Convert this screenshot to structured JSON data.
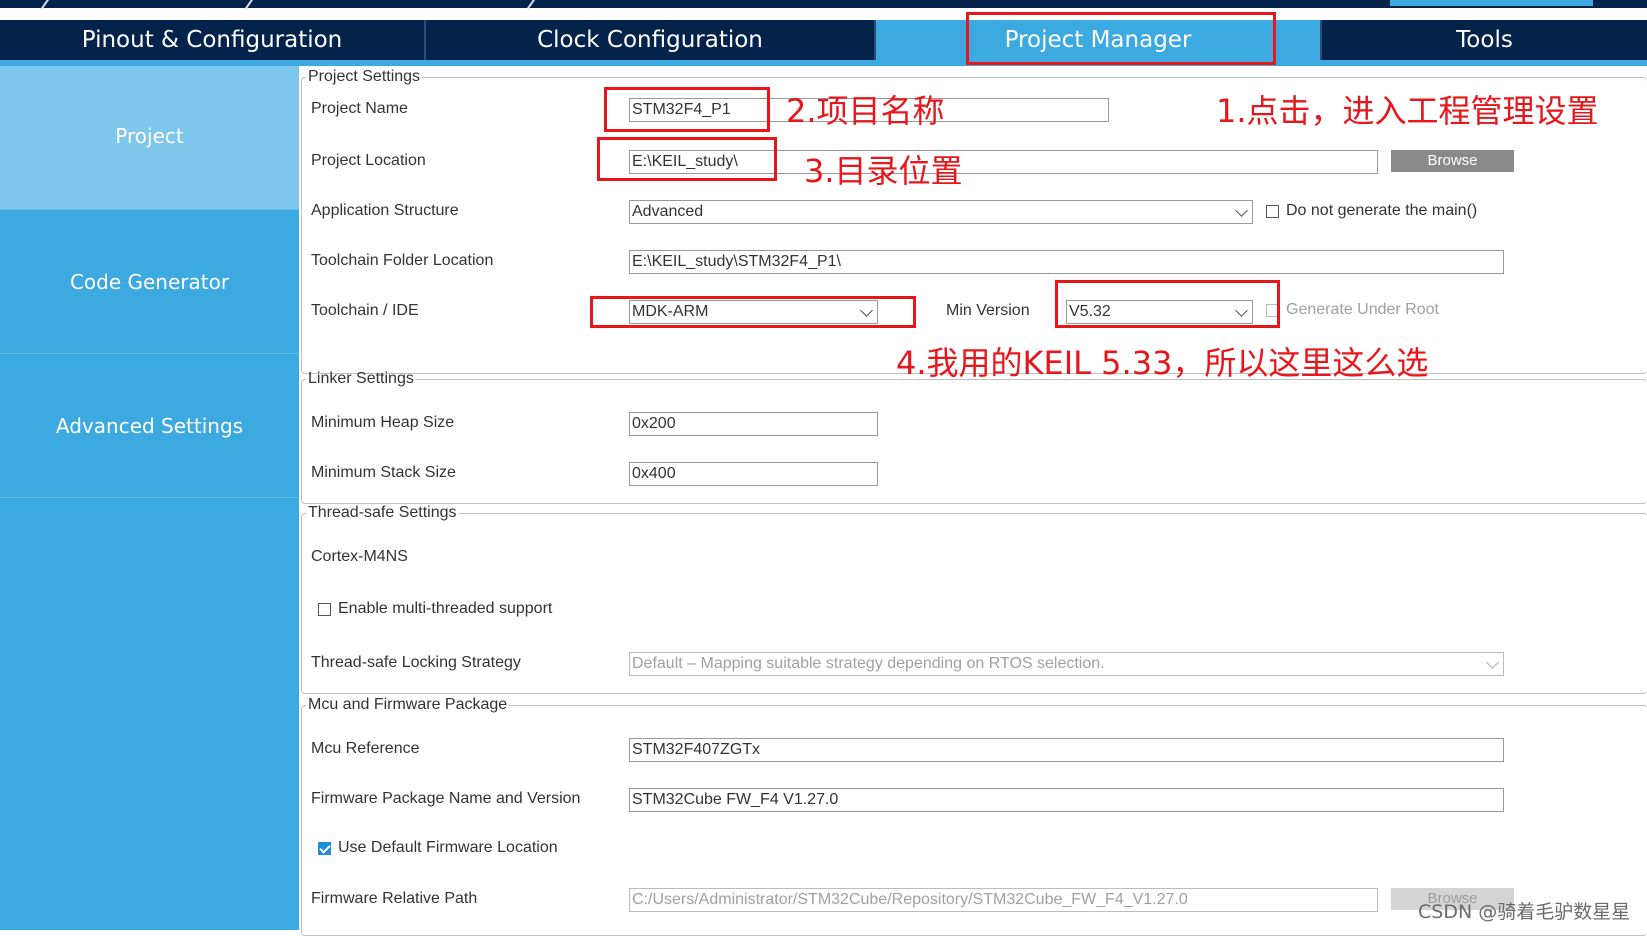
{
  "tabs": [
    {
      "label": "Pinout & Configuration",
      "active": false
    },
    {
      "label": "Clock Configuration",
      "active": false
    },
    {
      "label": "Project Manager",
      "active": true
    },
    {
      "label": "Tools",
      "active": false
    }
  ],
  "sidebar": {
    "items": [
      {
        "label": "Project",
        "active": true
      },
      {
        "label": "Code Generator",
        "active": false
      },
      {
        "label": "Advanced Settings",
        "active": false
      }
    ]
  },
  "project_settings": {
    "legend": "Project Settings",
    "project_name_label": "Project Name",
    "project_name_value": "STM32F4_P1",
    "project_location_label": "Project Location",
    "project_location_value": "E:\\KEIL_study\\",
    "browse_label": "Browse",
    "app_structure_label": "Application Structure",
    "app_structure_value": "Advanced",
    "no_main_label": "Do not generate the main()",
    "no_main_checked": false,
    "toolchain_folder_label": "Toolchain Folder Location",
    "toolchain_folder_value": "E:\\KEIL_study\\STM32F4_P1\\",
    "toolchain_label": "Toolchain / IDE",
    "toolchain_value": "MDK-ARM",
    "min_version_label": "Min Version",
    "min_version_value": "V5.32",
    "gen_under_root_label": "Generate Under Root",
    "gen_under_root_checked": false
  },
  "linker_settings": {
    "legend": "Linker Settings",
    "heap_label": "Minimum Heap Size",
    "heap_value": "0x200",
    "stack_label": "Minimum Stack Size",
    "stack_value": "0x400"
  },
  "thread_safe": {
    "legend": "Thread-safe Settings",
    "core": "Cortex-M4NS",
    "multi_thread_label": "Enable multi-threaded support",
    "multi_thread_checked": false,
    "strategy_label": "Thread-safe Locking Strategy",
    "strategy_value": "Default  –  Mapping suitable strategy depending on RTOS selection."
  },
  "mcu_firmware": {
    "legend": "Mcu and Firmware Package",
    "mcu_ref_label": "Mcu Reference",
    "mcu_ref_value": "STM32F407ZGTx",
    "fw_name_label": "Firmware Package Name and Version",
    "fw_name_value": "STM32Cube FW_F4 V1.27.0",
    "use_default_label": "Use Default Firmware Location",
    "use_default_checked": true,
    "fw_path_label": "Firmware Relative Path",
    "fw_path_value": "C:/Users/Administrator/STM32Cube/Repository/STM32Cube_FW_F4_V1.27.0",
    "browse_label": "Browse"
  },
  "annotations": {
    "note1": "1.点击，进入工程管理设置",
    "note2": "2.项目名称",
    "note3": "3.目录位置",
    "note4": "4.我用的KEIL 5.33，所以这里这么选",
    "color": "#e8151a"
  },
  "watermark": "CSDN @骑着毛驴数星星",
  "colors": {
    "navy": "#03234b",
    "accent": "#3ca9e1",
    "sidebar_active": "#7dc7ec"
  }
}
